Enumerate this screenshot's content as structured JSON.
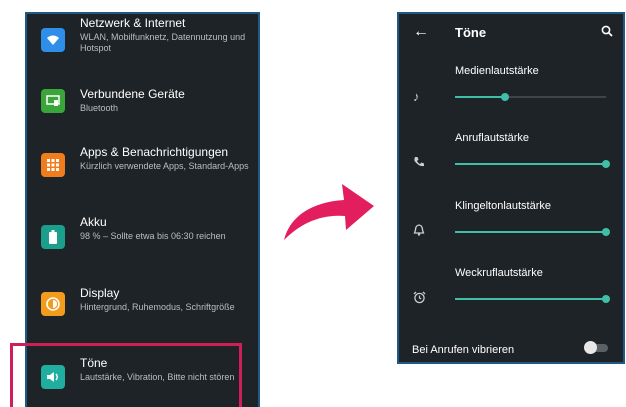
{
  "settings_list": {
    "items": [
      {
        "title": "Netzwerk & Internet",
        "subtitle": "WLAN, Mobilfunknetz, Datennutzung und Hotspot",
        "icon": "wifi-icon",
        "color": "#2f8fe8"
      },
      {
        "title": "Verbundene Geräte",
        "subtitle": "Bluetooth",
        "icon": "connected-devices-icon",
        "color": "#3aa63a"
      },
      {
        "title": "Apps & Benachrichtigungen",
        "subtitle": "Kürzlich verwendete Apps, Standard-Apps",
        "icon": "apps-grid-icon",
        "color": "#f07c1c"
      },
      {
        "title": "Akku",
        "subtitle": "98 % – Sollte etwa bis 06:30 reichen",
        "icon": "battery-icon",
        "color": "#1b9e8c"
      },
      {
        "title": "Display",
        "subtitle": "Hintergrund, Ruhemodus, Schriftgröße",
        "icon": "display-brightness-icon",
        "color": "#f39b1b"
      },
      {
        "title": "Töne",
        "subtitle": "Lautstärke, Vibration, Bitte nicht stören",
        "icon": "volume-icon",
        "color": "#1fae9f"
      }
    ],
    "highlight_color": "#cf1f56"
  },
  "arrow": {
    "color": "#e21e5f"
  },
  "sound_screen": {
    "title": "Töne",
    "back_icon": "back-arrow-icon",
    "search_icon": "search-icon",
    "volumes": [
      {
        "label": "Medienlautstärke",
        "icon": "music-note-icon",
        "level": 0.33
      },
      {
        "label": "Anruflautstärke",
        "icon": "phone-icon",
        "level": 1.0
      },
      {
        "label": "Klingeltonlautstärke",
        "icon": "bell-icon",
        "level": 1.0
      },
      {
        "label": "Weckruflautstärke",
        "icon": "alarm-clock-icon",
        "level": 1.0
      }
    ],
    "vibrate_label": "Bei Anrufen vibrieren",
    "vibrate_on": false,
    "accent_color": "#3fbfa8"
  }
}
